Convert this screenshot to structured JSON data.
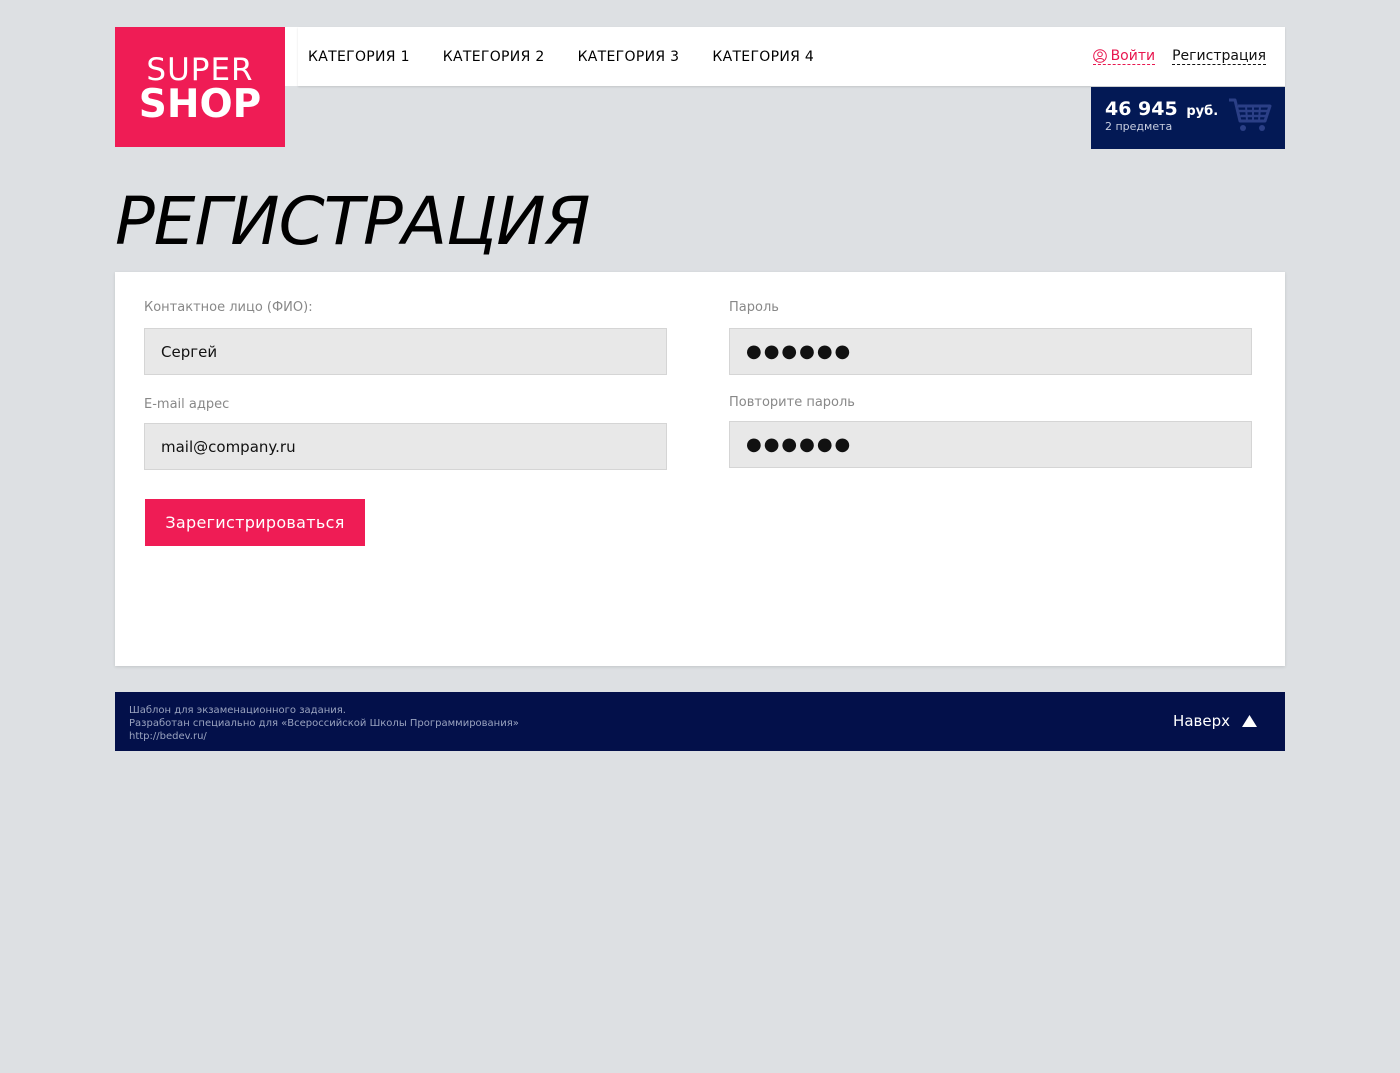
{
  "logo": {
    "line1": "SUPER",
    "line2": "SHOP"
  },
  "nav": {
    "items": [
      {
        "label": "КАТЕГОРИЯ 1"
      },
      {
        "label": "КАТЕГОРИЯ 2"
      },
      {
        "label": "КАТЕГОРИЯ 3"
      },
      {
        "label": "КАТЕГОРИЯ 4"
      }
    ]
  },
  "auth": {
    "login_label": "Войти",
    "register_label": "Регистрация",
    "login_icon": "user-icon"
  },
  "cart": {
    "total": "46 945",
    "currency": "руб.",
    "count_text": "2 предмета",
    "icon": "cart-icon"
  },
  "page": {
    "title": "РЕГИСТРАЦИЯ"
  },
  "form": {
    "name_label": "Контактное лицо (ФИО):",
    "name_value": "Сергей",
    "email_label": "E-mail адрес",
    "email_value": "mail@company.ru",
    "password_label": "Пароль",
    "password_value": "●●●●●●",
    "repeat_label": "Повторите пароль",
    "repeat_value": "●●●●●●",
    "submit_label": "Зарегистрироваться"
  },
  "footer": {
    "line1": "Шаблон для экзаменационного задания.",
    "line2": "Разработан специально для «Всероссийской Школы Программирования»",
    "line3": "http://bedev.ru/",
    "up_label": "Наверх",
    "up_icon": "triangle-up-icon"
  },
  "colors": {
    "accent": "#ef1c55",
    "dark": "#031955",
    "footer": "#03104a",
    "background": "#dde0e3"
  }
}
